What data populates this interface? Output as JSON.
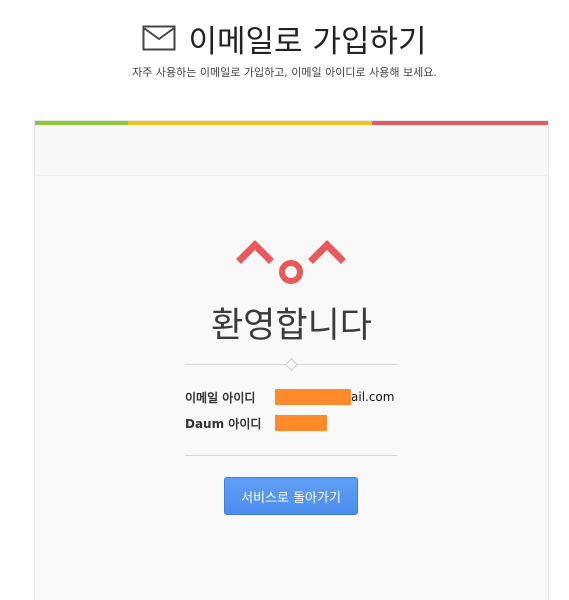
{
  "header": {
    "title": "이메일로 가입하기",
    "subtitle": "자주 사용하는 이메일로 가입하고, 이메일 아이디로 사용해 보세요.",
    "icon": "mail-icon"
  },
  "card": {
    "topbar_colors": [
      "#8cc63f",
      "#f2c31a",
      "#f2c31a",
      "#e85a5a"
    ],
    "welcome_text": "환영합니다",
    "face_icon": "happy-face-icon",
    "fields": [
      {
        "label": "이메일 아이디",
        "value_visible_suffix": "ail.com"
      },
      {
        "label": "Daum 아이디",
        "value_visible_suffix": ""
      }
    ],
    "cta_label": "서비스로 돌아가기"
  }
}
